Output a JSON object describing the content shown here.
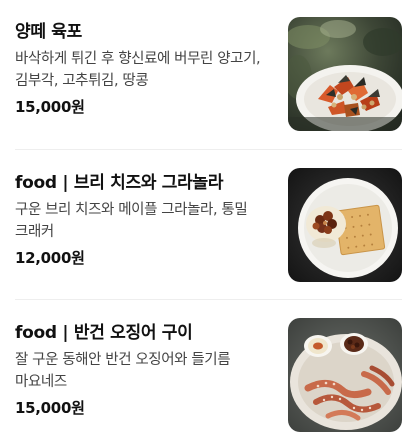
{
  "menu": {
    "items": [
      {
        "name": "양떼 육포",
        "description": "바삭하게 튀긴 후 향신료에 버무린 양고기, 김부각, 고추튀김, 땅콩",
        "price": "15,000원",
        "image_icon": "lamb-jerky-photo"
      },
      {
        "name": "food | 브리 치즈와 그라놀라",
        "description": "구운 브리 치즈와 메이플 그라놀라, 통밀 크래커",
        "price": "12,000원",
        "image_icon": "brie-granola-photo"
      },
      {
        "name": "food | 반건 오징어 구이",
        "description": "잘 구운 동해안 반건 오징어와 들기름 마요네즈",
        "price": "15,000원",
        "image_icon": "grilled-squid-photo"
      }
    ]
  }
}
